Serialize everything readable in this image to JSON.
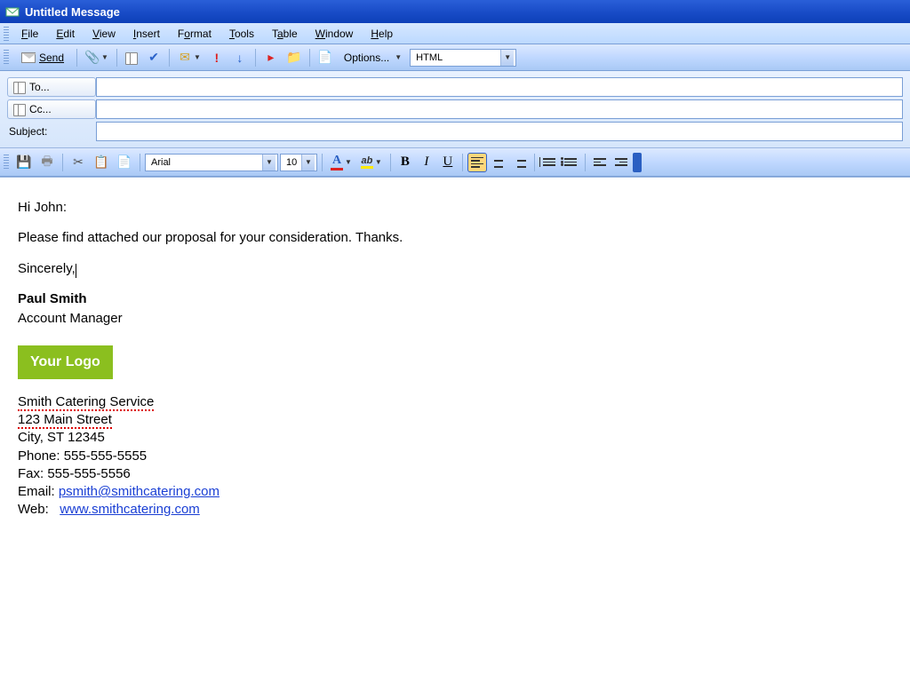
{
  "window": {
    "title": "Untitled Message"
  },
  "menu": {
    "items": [
      "File",
      "Edit",
      "View",
      "Insert",
      "Format",
      "Tools",
      "Table",
      "Window",
      "Help"
    ]
  },
  "toolbar1": {
    "send": "Send",
    "options": "Options...",
    "format_select": "HTML"
  },
  "envelope": {
    "to_label": "To...",
    "cc_label": "Cc...",
    "subject_label": "Subject:",
    "to_value": "",
    "cc_value": "",
    "subject_value": ""
  },
  "format_bar": {
    "font": "Arial",
    "size": "10"
  },
  "body": {
    "greeting": "Hi John:",
    "line1": "Please find attached our proposal for your consideration.  Thanks.",
    "closing": "Sincerely,",
    "name": "Paul Smith",
    "title": "Account Manager",
    "logo_text": "Your Logo",
    "company": "Smith Catering Service",
    "street": "123 Main Street",
    "citystate": "City, ST 12345",
    "phone_label": "Phone: ",
    "phone": "555-555-5555",
    "fax_label": "Fax: ",
    "fax": "555-555-5556",
    "email_label": "Email: ",
    "email": "psmith@smithcatering.com",
    "web_label": "Web:   ",
    "web": "www.smithcatering.com"
  }
}
